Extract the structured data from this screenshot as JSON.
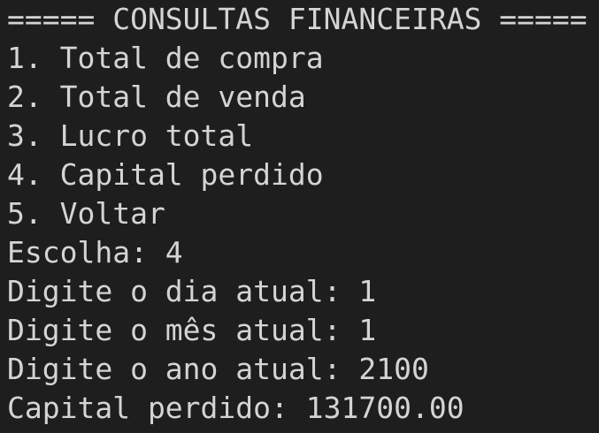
{
  "terminal": {
    "lines": [
      "===== CONSULTAS FINANCEIRAS =====",
      "1. Total de compra",
      "2. Total de venda",
      "3. Lucro total",
      "4. Capital perdido",
      "5. Voltar",
      "Escolha: 4",
      "Digite o dia atual: 1",
      "Digite o mês atual: 1",
      "Digite o ano atual: 2100",
      "Capital perdido: 131700.00"
    ]
  },
  "colors": {
    "background": "#1e1e1e",
    "text": "#d4d4d4"
  }
}
